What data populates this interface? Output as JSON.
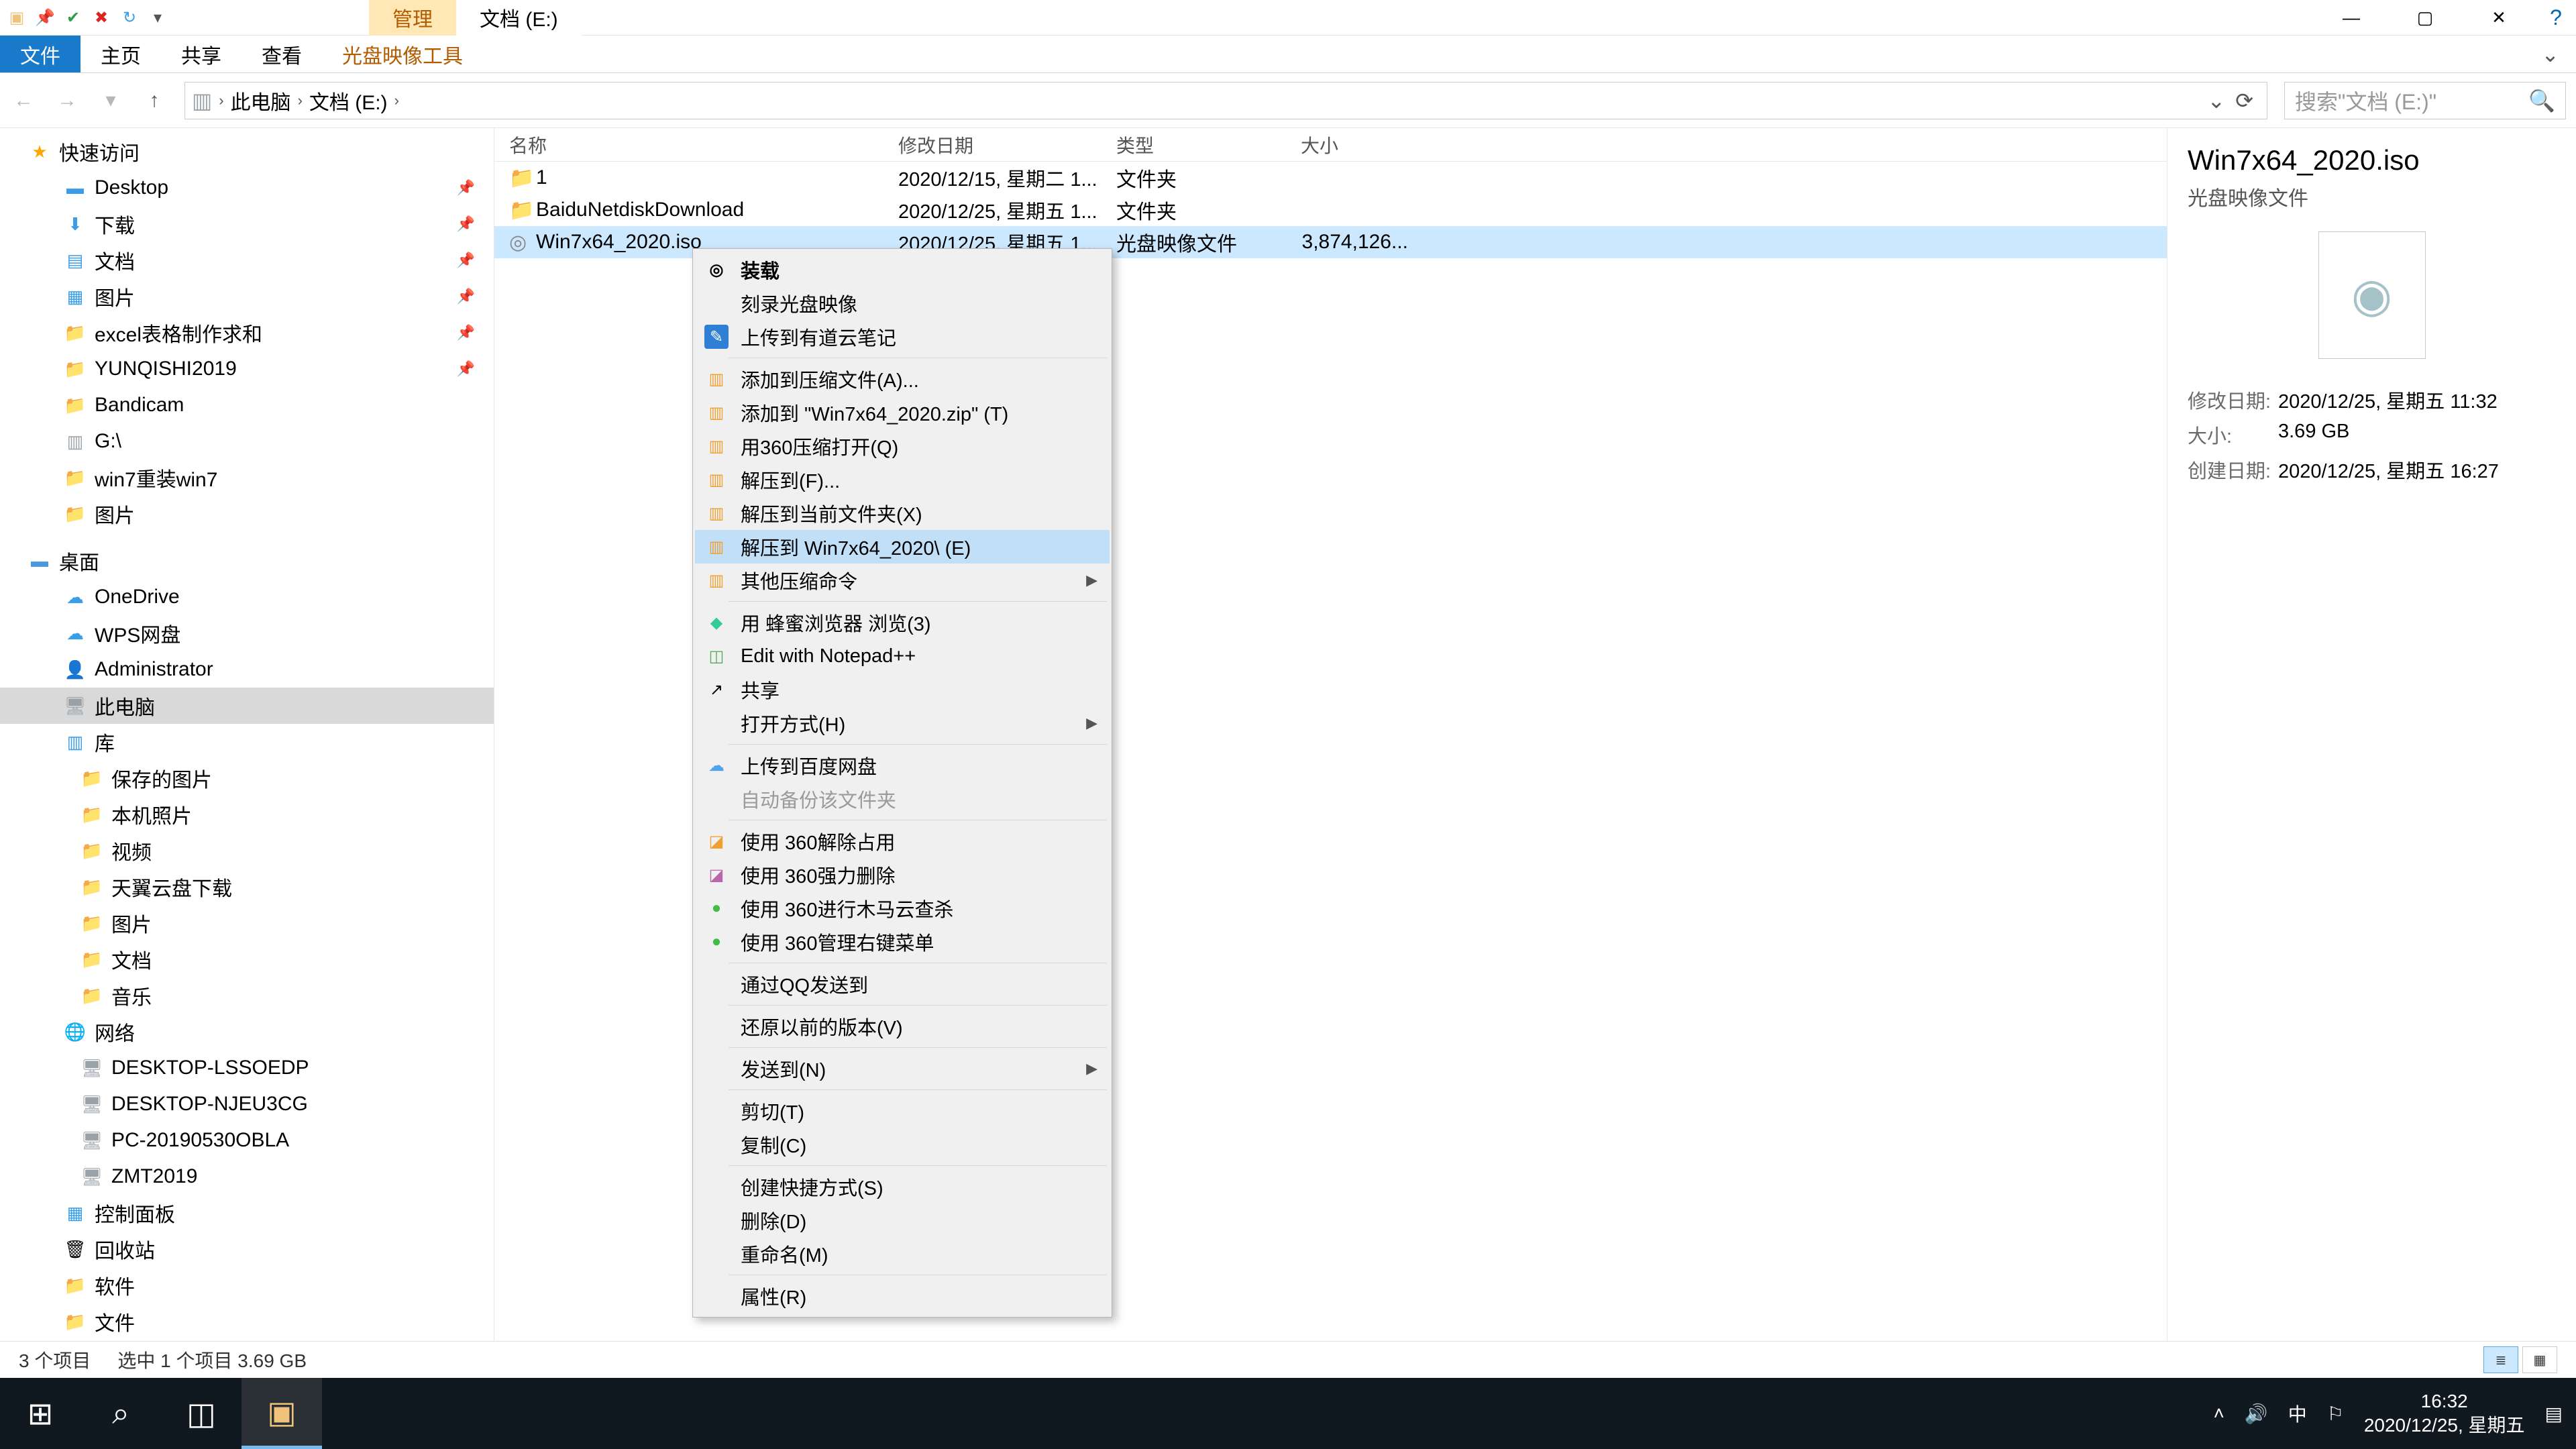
{
  "title_tabs": {
    "manage": "管理",
    "location": "文档 (E:)"
  },
  "ribbon": {
    "file": "文件",
    "home": "主页",
    "share": "共享",
    "view": "查看",
    "iso_tools": "光盘映像工具"
  },
  "breadcrumb": {
    "this_pc": "此电脑",
    "drive": "文档 (E:)"
  },
  "search": {
    "placeholder": "搜索\"文档 (E:)\""
  },
  "nav": {
    "quick_access": "快速访问",
    "qa_items": [
      "Desktop",
      "下载",
      "文档",
      "图片",
      "excel表格制作求和",
      "YUNQISHI2019",
      "Bandicam",
      "G:\\",
      "win7重装win7",
      "图片"
    ],
    "desktop": "桌面",
    "onedrive": "OneDrive",
    "wps": "WPS网盘",
    "admin": "Administrator",
    "this_pc": "此电脑",
    "libraries": "库",
    "lib_items": [
      "保存的图片",
      "本机照片",
      "视频",
      "天翼云盘下载",
      "图片",
      "文档",
      "音乐"
    ],
    "network": "网络",
    "net_items": [
      "DESKTOP-LSSOEDP",
      "DESKTOP-NJEU3CG",
      "PC-20190530OBLA",
      "ZMT2019"
    ],
    "control_panel": "控制面板",
    "recycle": "回收站",
    "software": "软件",
    "files": "文件"
  },
  "columns": {
    "name": "名称",
    "date": "修改日期",
    "type": "类型",
    "size": "大小"
  },
  "rows": [
    {
      "name": "1",
      "date": "2020/12/15, 星期二 1...",
      "type": "文件夹",
      "size": ""
    },
    {
      "name": "BaiduNetdiskDownload",
      "date": "2020/12/25, 星期五 1...",
      "type": "文件夹",
      "size": ""
    },
    {
      "name": "Win7x64_2020.iso",
      "date": "2020/12/25, 星期五 1...",
      "type": "光盘映像文件",
      "size": "3,874,126..."
    }
  ],
  "context_menu": {
    "mount": "装载",
    "burn": "刻录光盘映像",
    "youdao": "上传到有道云笔记",
    "add_archive": "添加到压缩文件(A)...",
    "add_zip": "添加到 \"Win7x64_2020.zip\" (T)",
    "open_360": "用360压缩打开(Q)",
    "extract_f": "解压到(F)...",
    "extract_here": "解压到当前文件夹(X)",
    "extract_named": "解压到 Win7x64_2020\\ (E)",
    "other_compress": "其他压缩命令",
    "honey": "用 蜂蜜浏览器 浏览(3)",
    "notepad": "Edit with Notepad++",
    "share": "共享",
    "open_with": "打开方式(H)",
    "upload_baidu": "上传到百度网盘",
    "auto_backup": "自动备份该文件夹",
    "rel_360_1": "使用 360解除占用",
    "rel_360_2": "使用 360强力删除",
    "rel_360_3": "使用 360进行木马云查杀",
    "rel_360_4": "使用 360管理右键菜单",
    "qq_send": "通过QQ发送到",
    "restore": "还原以前的版本(V)",
    "send_to": "发送到(N)",
    "cut": "剪切(T)",
    "copy": "复制(C)",
    "shortcut": "创建快捷方式(S)",
    "delete": "删除(D)",
    "rename": "重命名(M)",
    "properties": "属性(R)"
  },
  "details": {
    "title": "Win7x64_2020.iso",
    "subtitle": "光盘映像文件",
    "modified_label": "修改日期:",
    "modified": "2020/12/25, 星期五 11:32",
    "size_label": "大小:",
    "size": "3.69 GB",
    "created_label": "创建日期:",
    "created": "2020/12/25, 星期五 16:27"
  },
  "status": {
    "count": "3 个项目",
    "selected": "选中 1 个项目  3.69 GB"
  },
  "taskbar": {
    "ime": "中",
    "time": "16:32",
    "date": "2020/12/25, 星期五"
  }
}
